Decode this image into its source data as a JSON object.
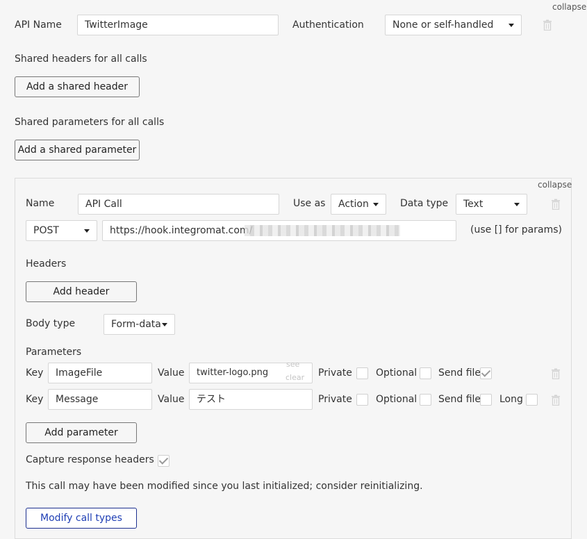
{
  "top": {
    "collapse_label": "collapse",
    "api_name_label": "API Name",
    "api_name_value": "TwitterImage",
    "auth_label": "Authentication",
    "auth_value": "None or self-handled",
    "shared_headers_label": "Shared headers for all calls",
    "add_shared_header": "Add a shared header",
    "shared_params_label": "Shared parameters for all calls",
    "add_shared_param": "Add a shared parameter"
  },
  "call": {
    "collapse_label": "collapse",
    "name_label": "Name",
    "name_value": "API Call",
    "use_as_label": "Use as",
    "use_as_value": "Action",
    "data_type_label": "Data type",
    "data_type_value": "Text",
    "method_value": "POST",
    "url_value": "https://hook.integromat.com/",
    "url_hint": "(use [] for params)",
    "headers_label": "Headers",
    "add_header": "Add header",
    "body_type_label": "Body type",
    "body_type_value": "Form-data",
    "parameters_label": "Parameters",
    "params": [
      {
        "key_label": "Key",
        "key_value": "ImageFile",
        "value_label": "Value",
        "value_value": "twitter-logo.png",
        "see_label": "see",
        "clear_label": "clear",
        "private_label": "Private",
        "private_checked": false,
        "optional_label": "Optional",
        "optional_checked": false,
        "send_file_label": "Send file",
        "send_file_checked": true
      },
      {
        "key_label": "Key",
        "key_value": "Message",
        "value_label": "Value",
        "value_value": "テスト",
        "private_label": "Private",
        "private_checked": false,
        "optional_label": "Optional",
        "optional_checked": false,
        "send_file_label": "Send file",
        "send_file_checked": false,
        "long_label": "Long",
        "long_checked": false
      }
    ],
    "add_parameter": "Add parameter",
    "capture_label": "Capture response headers",
    "capture_checked": true,
    "warning_text": "This call may have been modified since you last initialized; consider reinitializing.",
    "modify_call_types": "Modify call types"
  },
  "icons": {
    "trash": "trash-icon",
    "caret": "caret-down-icon",
    "check": "checkmark-icon"
  }
}
